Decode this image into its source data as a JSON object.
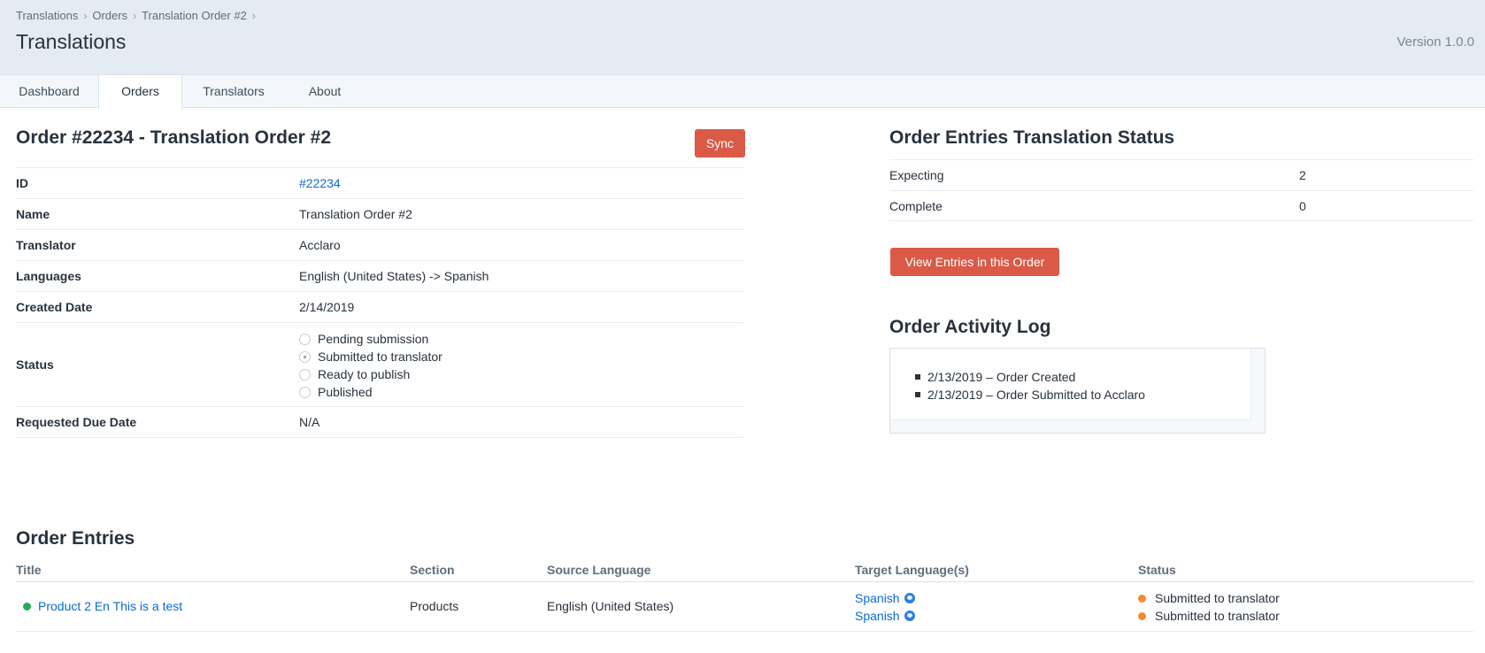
{
  "breadcrumb": {
    "items": [
      "Translations",
      "Orders",
      "Translation Order #2"
    ],
    "separator": "›"
  },
  "header": {
    "title": "Translations",
    "version": "Version 1.0.0"
  },
  "tabs": [
    {
      "label": "Dashboard",
      "active": false
    },
    {
      "label": "Orders",
      "active": true
    },
    {
      "label": "Translators",
      "active": false
    },
    {
      "label": "About",
      "active": false
    }
  ],
  "order": {
    "title": "Order #22234 - Translation Order #2",
    "sync_label": "Sync",
    "fields": {
      "id": {
        "label": "ID",
        "value": "#22234"
      },
      "name": {
        "label": "Name",
        "value": "Translation Order #2"
      },
      "translator": {
        "label": "Translator",
        "value": "Acclaro"
      },
      "languages": {
        "label": "Languages",
        "value": "English (United States) -> Spanish"
      },
      "created": {
        "label": "Created Date",
        "value": "2/14/2019"
      },
      "status": {
        "label": "Status",
        "options": [
          "Pending submission",
          "Submitted to translator",
          "Ready to publish",
          "Published"
        ],
        "selected": "Submitted to translator"
      },
      "due": {
        "label": "Requested Due Date",
        "value": "N/A"
      }
    }
  },
  "translation_status": {
    "title": "Order Entries Translation Status",
    "rows": [
      {
        "label": "Expecting",
        "value": "2"
      },
      {
        "label": "Complete",
        "value": "0"
      }
    ],
    "button_label": "View Entries in this Order"
  },
  "activity_log": {
    "title": "Order Activity Log",
    "items": [
      "2/13/2019 – Order Created",
      "2/13/2019 – Order Submitted to Acclaro"
    ]
  },
  "entries": {
    "title": "Order Entries",
    "columns": [
      "Title",
      "Section",
      "Source Language",
      "Target Language(s)",
      "Status"
    ],
    "rows": [
      {
        "title": "Product 2 En This is a test",
        "section": "Products",
        "source": "English (United States)",
        "targets": [
          "Spanish",
          "Spanish"
        ],
        "statuses": [
          "Submitted to translator",
          "Submitted to translator"
        ]
      }
    ]
  },
  "colors": {
    "accent_red": "#da5a47",
    "link_blue": "#0b69d6",
    "header_bg": "#e4ebf3",
    "status_green": "#27ab59",
    "status_orange": "#f18c31"
  }
}
